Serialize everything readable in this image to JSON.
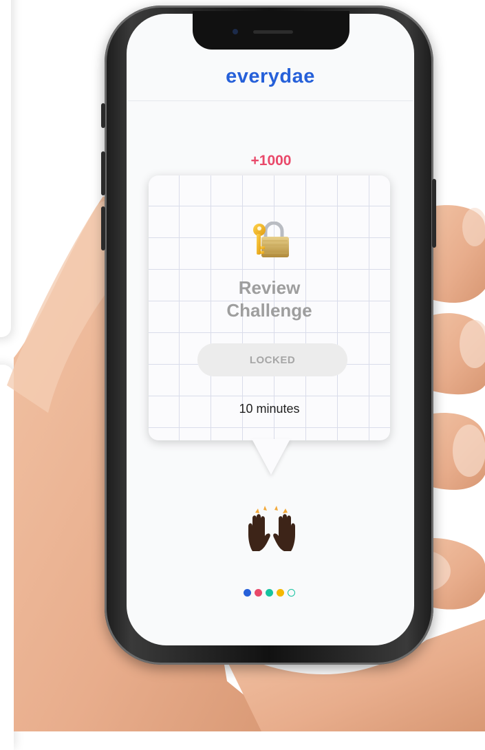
{
  "app": {
    "brand": "everydae",
    "brand_color": "#2660d9"
  },
  "challenge": {
    "points": "+1000",
    "points_color": "#e9496a",
    "icon": "lock-with-key-icon",
    "title_line1": "Review",
    "title_line2": "Challenge",
    "status_label": "LOCKED",
    "duration": "10 minutes"
  },
  "celebration": {
    "icon": "raising-hands-icon"
  },
  "pagination": {
    "dots": [
      {
        "color": "#2660d9",
        "filled": true
      },
      {
        "color": "#e9496a",
        "filled": true
      },
      {
        "color": "#17c3a0",
        "filled": true
      },
      {
        "color": "#f5b800",
        "filled": true
      },
      {
        "color": "#17c3a0",
        "filled": false
      }
    ]
  }
}
